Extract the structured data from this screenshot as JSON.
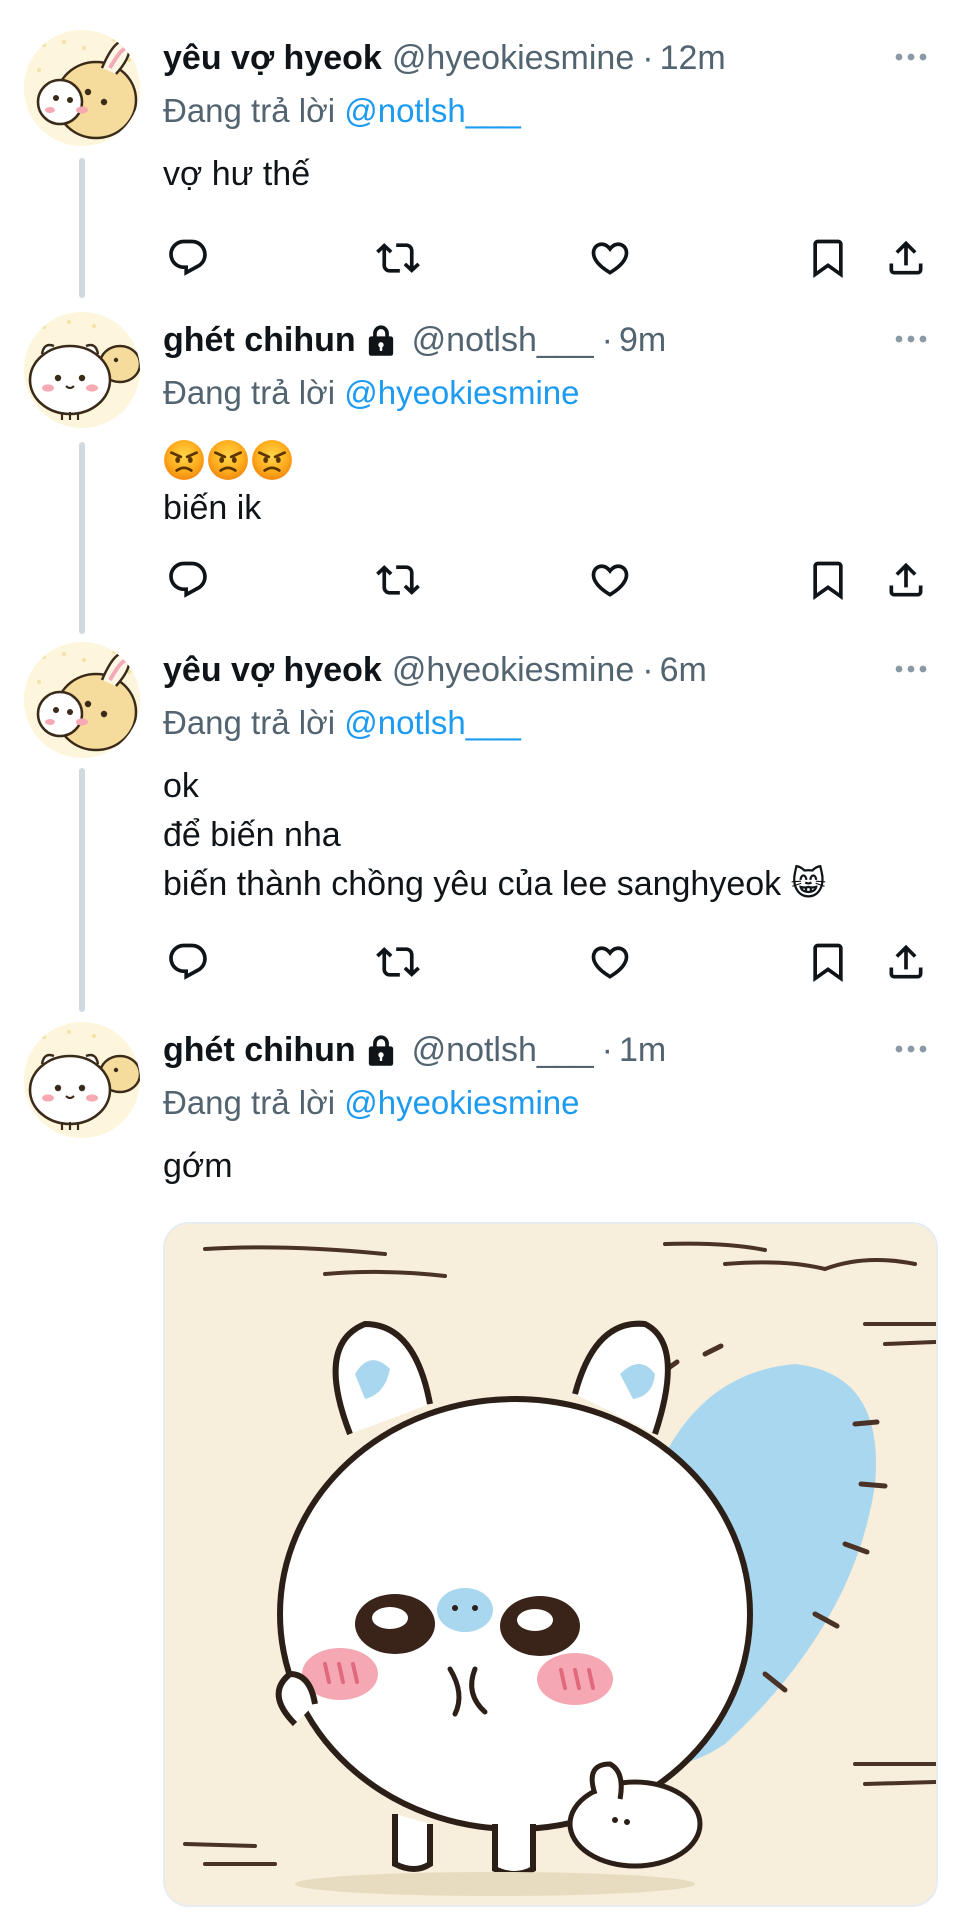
{
  "tweets": [
    {
      "name": "yêu vợ hyeok",
      "handle": "@hyeokiesmine",
      "dot": "·",
      "time": "12m",
      "reply_prefix": "Đang trả lời ",
      "reply_mention": "@notlsh___",
      "text": "vợ hư thế",
      "avatar": "bunny-avatar"
    },
    {
      "name": "ghét chihun",
      "handle": "@notlsh___",
      "dot": "·",
      "time": "9m",
      "reply_prefix": "Đang trả lời ",
      "reply_mention": "@hyeokiesmine",
      "emoji": [
        "angry-face-emoji",
        "angry-face-emoji",
        "angry-face-emoji"
      ],
      "text": "biến ik",
      "avatar": "hamster-avatar",
      "locked": true
    },
    {
      "name": "yêu vợ hyeok",
      "handle": "@hyeokiesmine",
      "dot": "·",
      "time": "6m",
      "reply_prefix": "Đang trả lời ",
      "reply_mention": "@notlsh___",
      "text": "ok\nđể biến nha\nbiến thành chồng yêu của lee sanghyeok 😸",
      "avatar": "bunny-avatar"
    },
    {
      "name": "ghét chihun",
      "handle": "@notlsh___",
      "dot": "·",
      "time": "1m",
      "reply_prefix": "Đang trả lời ",
      "reply_mention": "@hyeokiesmine",
      "text": "gớm",
      "avatar": "hamster-avatar",
      "locked": true,
      "media": "chiikawa-squirrel-image"
    }
  ],
  "icons": {
    "reply": "reply-icon",
    "retweet": "retweet-icon",
    "like": "heart-icon",
    "bookmark": "bookmark-icon",
    "share": "share-icon",
    "more": "more-icon",
    "lock": "lock-icon"
  },
  "colors": {
    "text": "#0f1419",
    "secondary": "#536471",
    "link": "#1d9bf0",
    "thread_line": "#cfd9de"
  }
}
